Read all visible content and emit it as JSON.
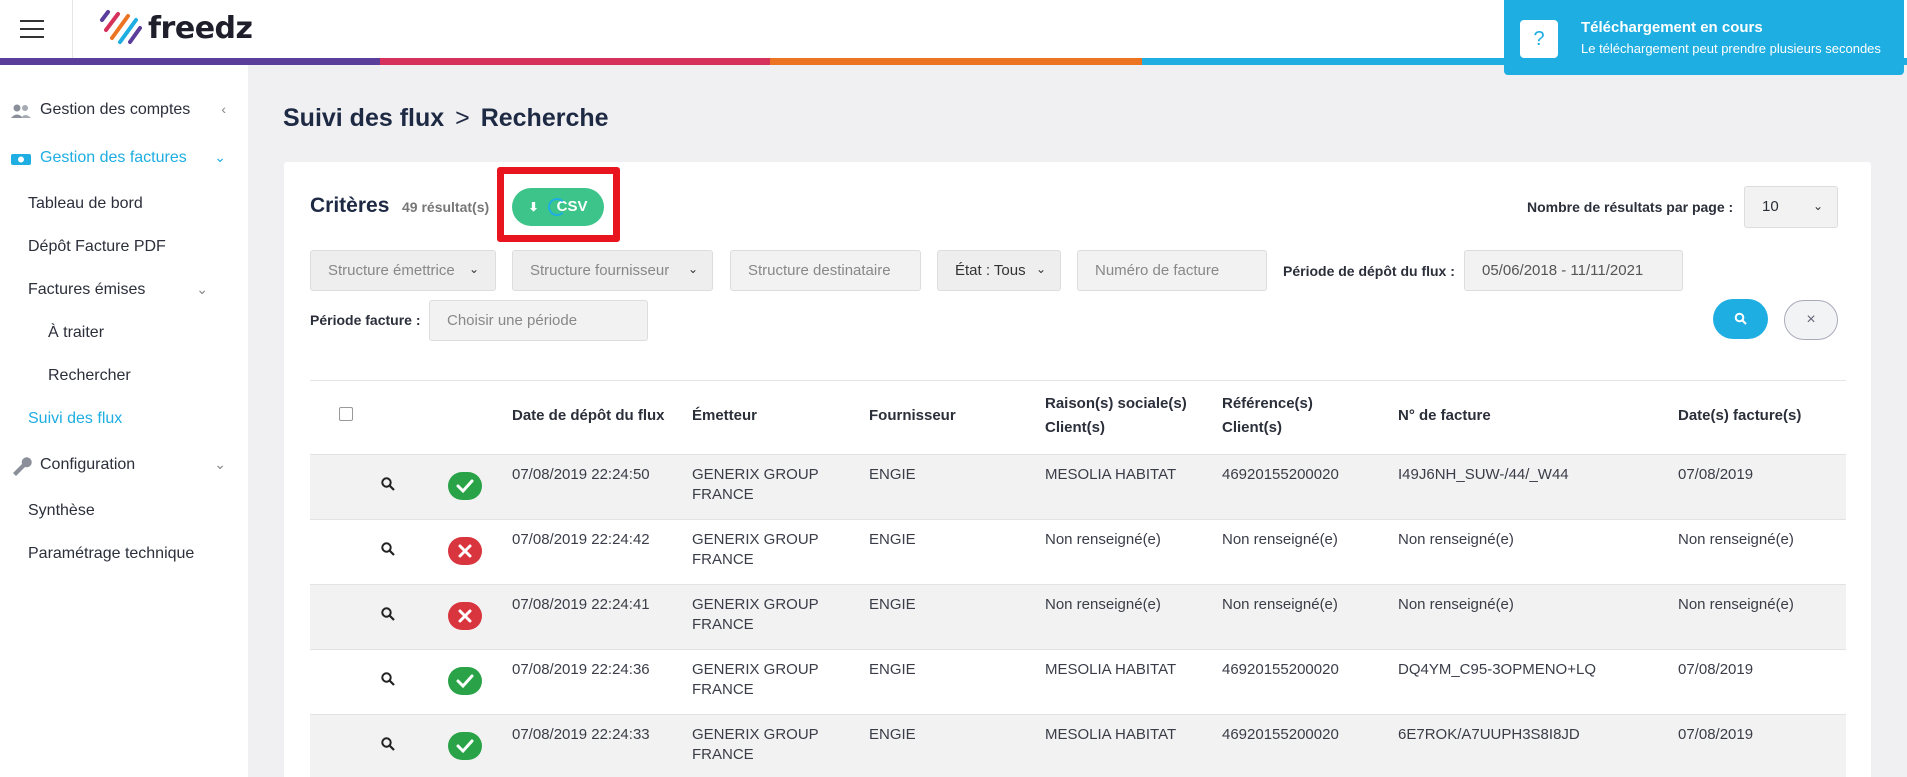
{
  "header": {
    "logo_text": "freedz",
    "colorbar": [
      "#5b3e9b",
      "#d6315a",
      "#ec7322",
      "#1eaee2"
    ]
  },
  "toast": {
    "icon": "?",
    "title": "Téléchargement en cours",
    "message": "Le téléchargement peut prendre plusieurs secondes"
  },
  "sidebar": {
    "items": [
      {
        "label": "Gestion des comptes",
        "icon": "users-icon"
      },
      {
        "label": "Gestion des factures",
        "icon": "invoice-icon"
      },
      {
        "label": "Tableau de bord"
      },
      {
        "label": "Dépôt Facture PDF"
      },
      {
        "label": "Factures émises"
      },
      {
        "label": "À traiter"
      },
      {
        "label": "Rechercher"
      },
      {
        "label": "Suivi des flux"
      },
      {
        "label": "Configuration",
        "icon": "wrench-icon"
      },
      {
        "label": "Synthèse"
      },
      {
        "label": "Paramétrage technique"
      }
    ]
  },
  "breadcrumb": {
    "part1": "Suivi des flux",
    "sep": ">",
    "part2": "Recherche"
  },
  "criteria": {
    "title": "Critères",
    "count": "49 résultat(s)",
    "csv_label": "CSV",
    "per_page_label": "Nombre de résultats par page :",
    "per_page_value": "10"
  },
  "filters": {
    "structure_emettrice": "Structure émettrice",
    "structure_fournisseur": "Structure fournisseur",
    "structure_destinataire": "Structure destinataire",
    "etat": "État : Tous",
    "numero_facture": "Numéro de facture",
    "periode_depot_label": "Période de dépôt du flux :",
    "periode_depot_value": "05/06/2018 - 11/11/2021",
    "periode_facture_label": "Période facture :",
    "periode_facture_placeholder": "Choisir une période",
    "clear_icon": "×"
  },
  "table": {
    "headers": {
      "date_depot": "Date de dépôt du flux",
      "emetteur": "Émetteur",
      "fournisseur": "Fournisseur",
      "raison_1": "Raison(s) sociale(s)",
      "raison_2": "Client(s)",
      "ref_1": "Référence(s)",
      "ref_2": "Client(s)",
      "num": "N° de facture",
      "date_fact": "Date(s) facture(s)"
    },
    "rows": [
      {
        "status": "ok",
        "date": "07/08/2019 22:24:50",
        "em1": "GENERIX GROUP",
        "em2": "FRANCE",
        "four": "ENGIE",
        "raison": "MESOLIA HABITAT",
        "ref": "46920155200020",
        "num": "I49J6NH_SUW-/44/_W44",
        "dfact": "07/08/2019"
      },
      {
        "status": "err",
        "date": "07/08/2019 22:24:42",
        "em1": "GENERIX GROUP",
        "em2": "FRANCE",
        "four": "ENGIE",
        "raison": "Non renseigné(e)",
        "ref": "Non renseigné(e)",
        "num": "Non renseigné(e)",
        "dfact": "Non renseigné(e)"
      },
      {
        "status": "err",
        "date": "07/08/2019 22:24:41",
        "em1": "GENERIX GROUP",
        "em2": "FRANCE",
        "four": "ENGIE",
        "raison": "Non renseigné(e)",
        "ref": "Non renseigné(e)",
        "num": "Non renseigné(e)",
        "dfact": "Non renseigné(e)"
      },
      {
        "status": "ok",
        "date": "07/08/2019 22:24:36",
        "em1": "GENERIX GROUP",
        "em2": "FRANCE",
        "four": "ENGIE",
        "raison": "MESOLIA HABITAT",
        "ref": "46920155200020",
        "num": "DQ4YM_C95-3OPMENO+LQ",
        "dfact": "07/08/2019"
      },
      {
        "status": "ok",
        "date": "07/08/2019 22:24:33",
        "em1": "GENERIX GROUP",
        "em2": "FRANCE",
        "four": "ENGIE",
        "raison": "MESOLIA HABITAT",
        "ref": "46920155200020",
        "num": "6E7ROK/A7UUPH3S8I8JD",
        "dfact": "07/08/2019"
      }
    ]
  }
}
